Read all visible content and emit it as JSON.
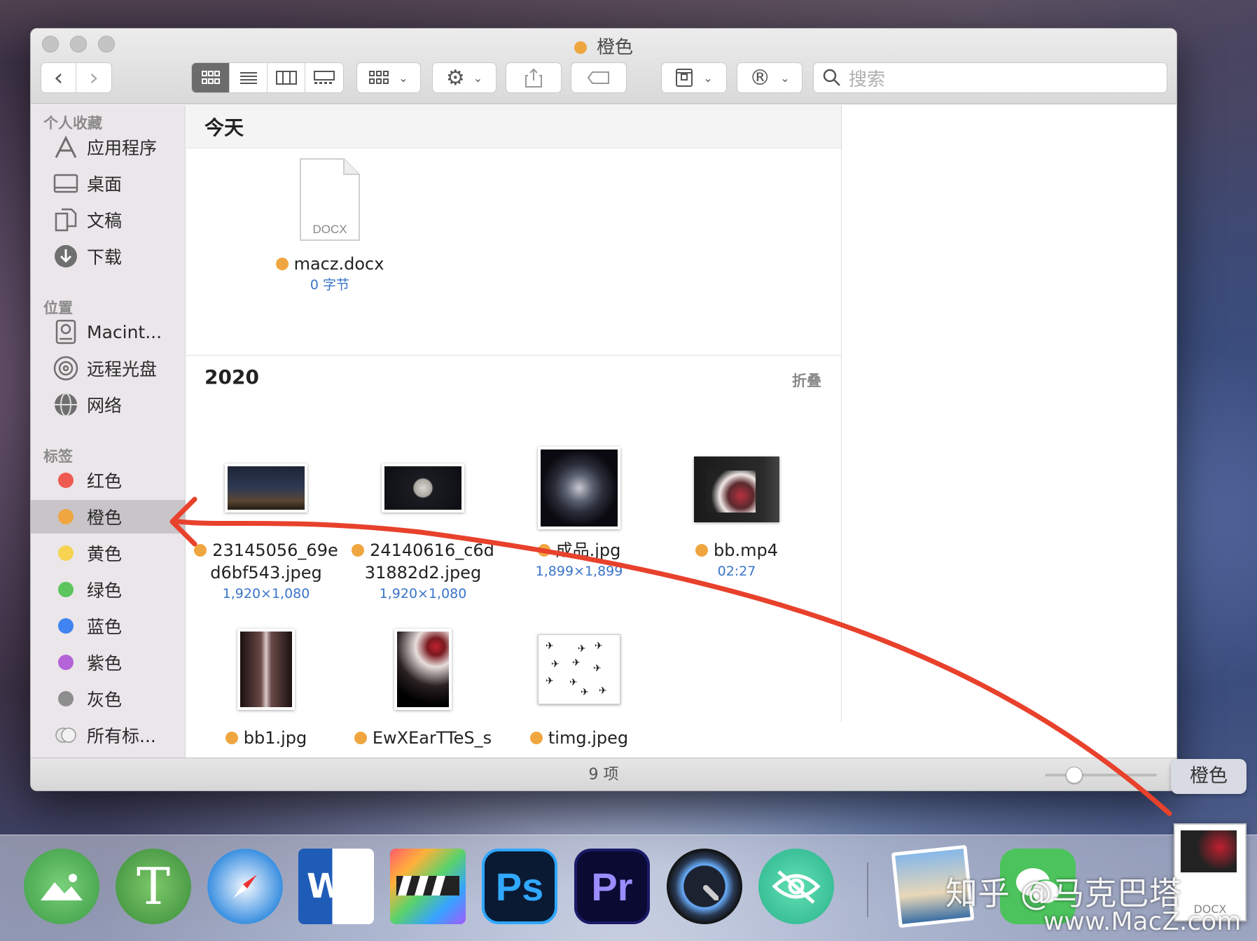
{
  "window": {
    "title": "橙色",
    "title_tag_color": "#f0a640"
  },
  "toolbar": {
    "back": "‹",
    "forward": "›",
    "search_placeholder": "搜索"
  },
  "sidebar": {
    "favorites_header": "个人收藏",
    "favorites": [
      {
        "label": "应用程序",
        "icon": "applications-icon"
      },
      {
        "label": "桌面",
        "icon": "desktop-icon"
      },
      {
        "label": "文稿",
        "icon": "documents-icon"
      },
      {
        "label": "下载",
        "icon": "downloads-icon"
      }
    ],
    "locations_header": "位置",
    "locations": [
      {
        "label": "Macint...",
        "icon": "hard-drive-icon"
      },
      {
        "label": "远程光盘",
        "icon": "remote-disc-icon"
      },
      {
        "label": "网络",
        "icon": "network-icon"
      }
    ],
    "tags_header": "标签",
    "tags": [
      {
        "label": "红色",
        "color": "#ef5a50"
      },
      {
        "label": "橙色",
        "color": "#f0a640"
      },
      {
        "label": "黄色",
        "color": "#f6d350"
      },
      {
        "label": "绿色",
        "color": "#5cc55d"
      },
      {
        "label": "蓝色",
        "color": "#3f84f0"
      },
      {
        "label": "紫色",
        "color": "#b563d8"
      },
      {
        "label": "灰色",
        "color": "#8e8e8e"
      },
      {
        "label": "所有标..."
      }
    ]
  },
  "groups": {
    "today": {
      "title": "今天"
    },
    "year": {
      "title": "2020",
      "collapse": "折叠"
    }
  },
  "files": {
    "macz": {
      "name": "macz.docx",
      "meta": "0 字节",
      "type_label": "DOCX"
    },
    "f1": {
      "name_line1": "23145056_69e",
      "name_line2": "d6bf543.jpeg",
      "meta": "1,920×1,080"
    },
    "f2": {
      "name_line1": "24140616_c6d",
      "name_line2": "31882d2.jpeg",
      "meta": "1,920×1,080"
    },
    "f3": {
      "name": "成品.jpg",
      "meta": "1,899×1,899"
    },
    "f4": {
      "name": "bb.mp4",
      "meta": "02:27"
    },
    "f5": {
      "name": "bb1.jpg"
    },
    "f6": {
      "name": "EwXEarTTeS_s"
    },
    "f7": {
      "name": "timg.jpeg"
    }
  },
  "status": {
    "count": "9 项"
  },
  "drag_tag": {
    "label": "橙色",
    "file_label": "DOCX"
  },
  "watermark": {
    "line1": "知乎 @马克巴塔",
    "line2": "www.MacZ.com"
  },
  "dock": {
    "word_letter": "W",
    "ps": "Ps",
    "pr": "Pr",
    "typora": "T"
  }
}
